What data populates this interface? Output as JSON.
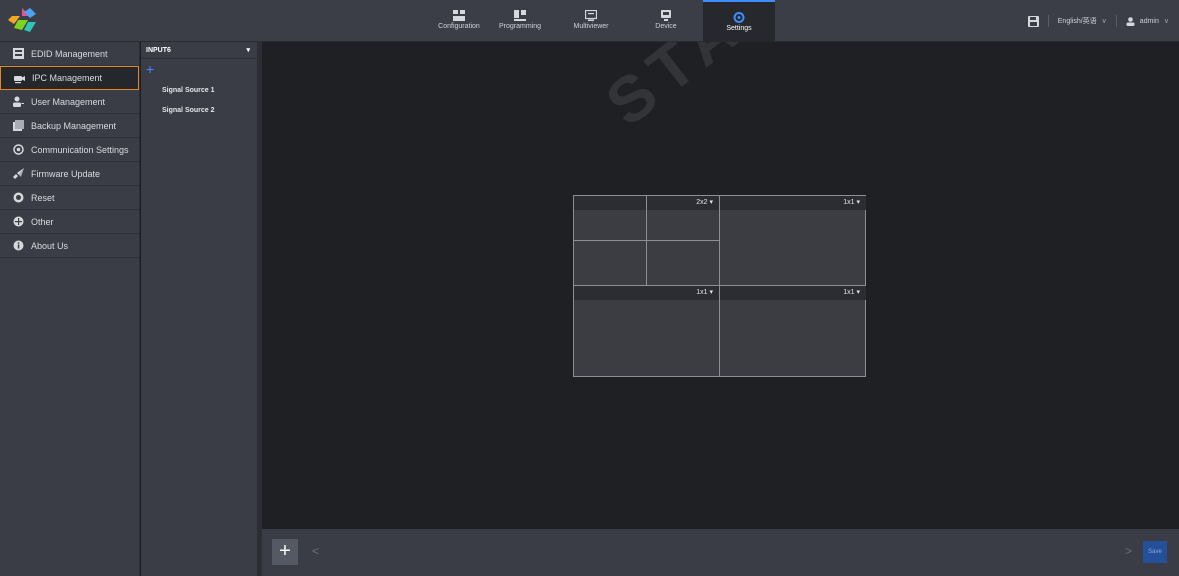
{
  "colors": {
    "accent": "#3f8cff",
    "active_border": "#e0891f",
    "save_bg": "#24509a"
  },
  "nav": {
    "tabs": [
      {
        "label": "Configuration",
        "icon": "grid-icon"
      },
      {
        "label": "Programming",
        "icon": "programming-icon"
      },
      {
        "label": "Multiviewer",
        "icon": "monitor-icon"
      },
      {
        "label": "Device",
        "icon": "device-icon"
      },
      {
        "label": "Settings",
        "icon": "gear-icon",
        "active": true
      }
    ],
    "language": "English/英语",
    "user": "admin"
  },
  "sidebar": {
    "items": [
      {
        "label": "EDID Management",
        "icon": "edid-icon"
      },
      {
        "label": "IPC Management",
        "icon": "camera-icon",
        "active": true
      },
      {
        "label": "User Management",
        "icon": "user-icon"
      },
      {
        "label": "Backup Management",
        "icon": "backup-icon"
      },
      {
        "label": "Communication Settings",
        "icon": "communication-icon"
      },
      {
        "label": "Firmware Update",
        "icon": "rocket-icon"
      },
      {
        "label": "Reset",
        "icon": "reset-icon"
      },
      {
        "label": "Other",
        "icon": "other-icon"
      },
      {
        "label": "About Us",
        "icon": "info-icon"
      }
    ]
  },
  "sources": {
    "selected_input": "INPUT6",
    "items": [
      "Signal Source 1",
      "Signal Source 2"
    ]
  },
  "layout_grid": {
    "quadrants": [
      {
        "split": "2x2"
      },
      {
        "split": "1x1"
      },
      {
        "split": "1x1"
      },
      {
        "split": "1x1"
      }
    ]
  },
  "watermark": "STAR TECH CO., LTD",
  "bottom": {
    "save_label": "Save"
  }
}
